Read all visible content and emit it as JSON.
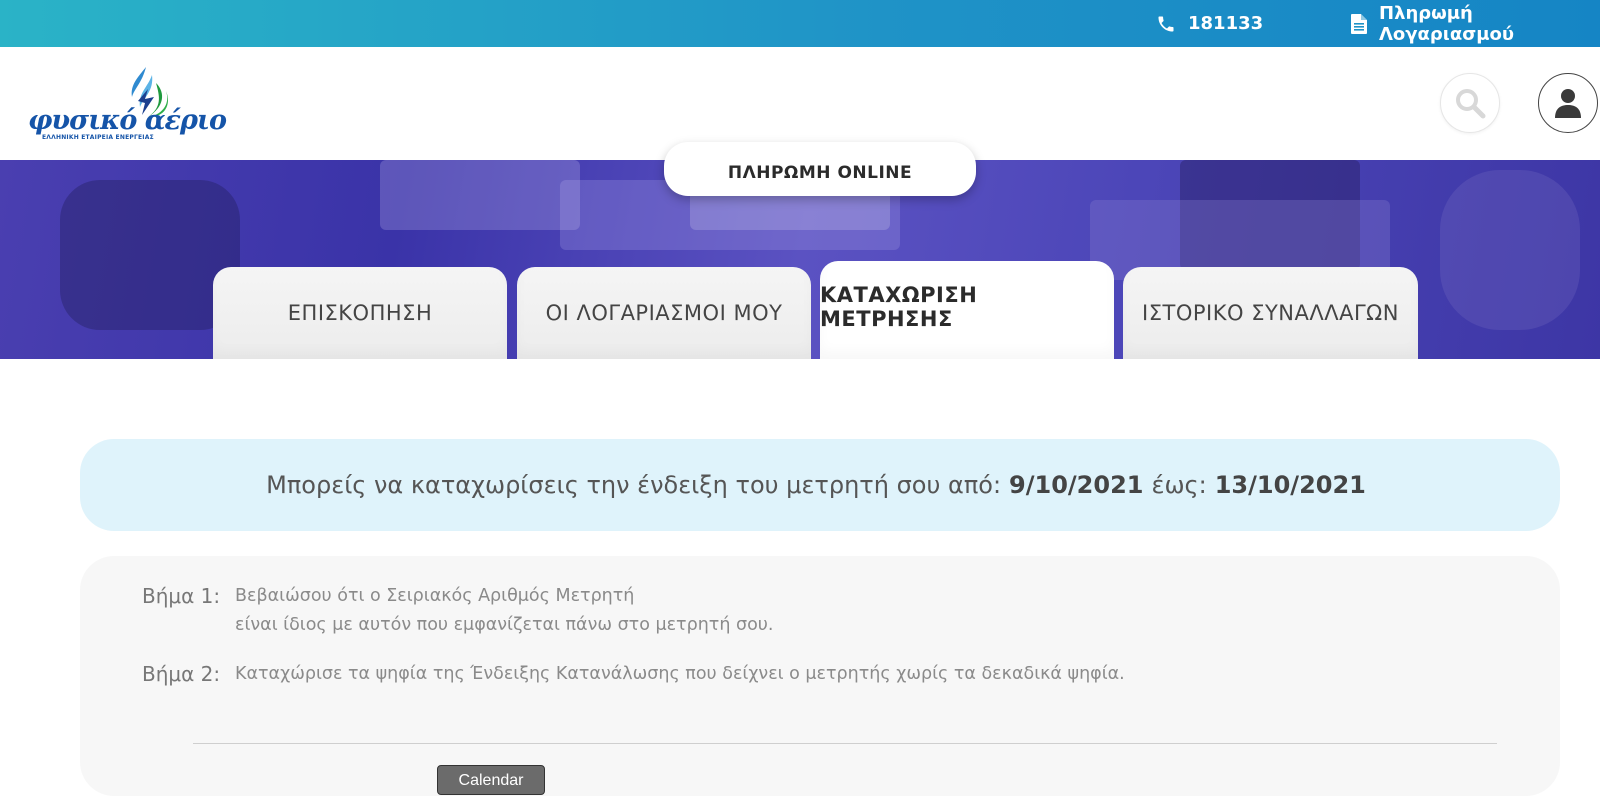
{
  "topbar": {
    "phone_icon": "phone-icon",
    "phone": "181133",
    "document_icon": "document-icon",
    "pay_bill": "Πληρωμή Λογαριασμού",
    "colors": {
      "gradient_start": "#2ab3c7",
      "gradient_end": "#1585c5"
    }
  },
  "header": {
    "logo_text": "φυσικό αέριο",
    "logo_subtitle": "ΕΛΛΗΝΙΚΗ ΕΤΑΙΡΕΙΑ ΕΝΕΡΓΕΙΑΣ",
    "search_icon": "search-icon",
    "user_icon": "user-icon"
  },
  "hero": {
    "pay_online": "ΠΛΗΡΩΜΗ ONLINE",
    "tabs": [
      {
        "label": "ΕΠΙΣΚΟΠΗΣΗ",
        "active": false
      },
      {
        "label": "ΟΙ ΛΟΓΑΡΙΑΣΜΟΙ ΜΟΥ",
        "active": false
      },
      {
        "label": "ΚΑΤΑΧΩΡΙΣΗ ΜΕΤΡΗΣΗΣ",
        "active": true
      },
      {
        "label": "ΙΣΤΟΡΙΚΟ ΣΥΝΑΛΛΑΓΩΝ",
        "active": false
      }
    ]
  },
  "notice": {
    "prefix": "Μπορείς να καταχωρίσεις την ένδειξη του μετρητή σου από:",
    "from_date": "9/10/2021",
    "middle": "έως:",
    "to_date": "13/10/2021",
    "background": "#dff3fb"
  },
  "steps": [
    {
      "label": "Βήμα 1:",
      "lines": [
        "Βεβαιώσου ότι ο Σειριακός Αριθμός Μετρητή",
        "είναι ίδιος με αυτόν που εμφανίζεται πάνω στο μετρητή σου."
      ]
    },
    {
      "label": "Βήμα 2:",
      "lines": [
        "Καταχώρισε τα ψηφία της Ένδειξης Κατανάλωσης που δείχνει ο μετρητής χωρίς τα δεκαδικά ψηφία."
      ]
    }
  ],
  "calendar_button": "Calendar"
}
